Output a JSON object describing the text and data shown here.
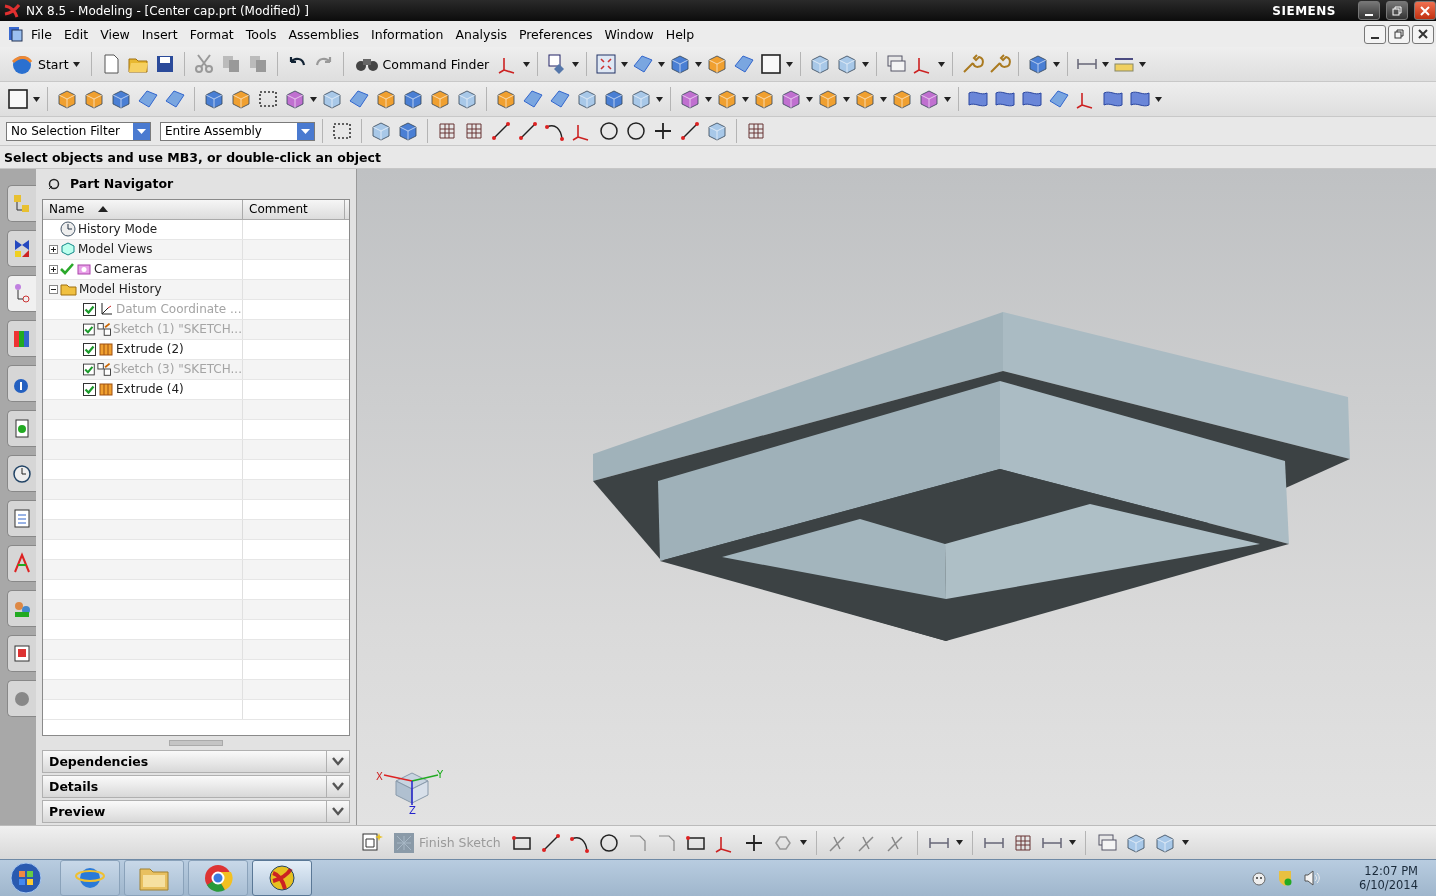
{
  "window": {
    "title": "NX 8.5 - Modeling - [Center cap.prt (Modified) ]",
    "brand": "SIEMENS"
  },
  "menu": [
    "File",
    "Edit",
    "View",
    "Insert",
    "Format",
    "Tools",
    "Assemblies",
    "Information",
    "Analysis",
    "Preferences",
    "Window",
    "Help"
  ],
  "toolbar": {
    "start": "Start",
    "command_finder": "Command Finder"
  },
  "selection_bar": {
    "filter": "No Selection Filter",
    "scope": "Entire Assembly"
  },
  "status": "Select objects and use MB3, or double-click an object",
  "resource_tabs": [
    {
      "selected": false
    },
    {
      "selected": false
    },
    {
      "selected": true
    },
    {
      "selected": false
    },
    {
      "selected": false
    },
    {
      "selected": false
    },
    {
      "selected": false
    },
    {
      "selected": false
    },
    {
      "selected": false
    },
    {
      "selected": false
    },
    {
      "selected": false
    },
    {
      "selected": false
    }
  ],
  "navigator": {
    "title": "Part Navigator",
    "columns": [
      "Name",
      "Comment"
    ],
    "tree": [
      {
        "kind": "mode",
        "label": "History Mode",
        "checked": false
      },
      {
        "kind": "views",
        "label": "Model Views",
        "checked": false,
        "expanded": false
      },
      {
        "kind": "cameras",
        "label": "Cameras",
        "checked": true,
        "expanded": false
      },
      {
        "kind": "group",
        "label": "Model History",
        "checked": false,
        "expanded": true,
        "children": [
          {
            "kind": "datum",
            "label": "Datum Coordinate ...",
            "checked": true,
            "disabled": true
          },
          {
            "kind": "sketch",
            "label": "Sketch (1) \"SKETCH...",
            "checked": true,
            "disabled": true
          },
          {
            "kind": "extrude",
            "label": "Extrude (2)",
            "checked": true,
            "disabled": false
          },
          {
            "kind": "sketch",
            "label": "Sketch (3) \"SKETCH...",
            "checked": true,
            "disabled": true
          },
          {
            "kind": "extrude",
            "label": "Extrude (4)",
            "checked": true,
            "disabled": false
          }
        ]
      }
    ],
    "sections": [
      {
        "label": "Dependencies",
        "expanded": false
      },
      {
        "label": "Details",
        "expanded": false
      },
      {
        "label": "Preview",
        "expanded": false
      }
    ]
  },
  "triad": [
    "X",
    "Y",
    "Z"
  ],
  "sketch_toolbar": {
    "finish": {
      "label": "Finish Sketch",
      "disabled": true
    }
  },
  "taskbar": {
    "apps": [
      {
        "kind": "browser",
        "selected": false
      },
      {
        "kind": "files",
        "selected": false
      },
      {
        "kind": "chrome",
        "selected": false
      },
      {
        "kind": "nx",
        "selected": true
      }
    ],
    "time": "12:07 PM",
    "date": "6/10/2014"
  }
}
